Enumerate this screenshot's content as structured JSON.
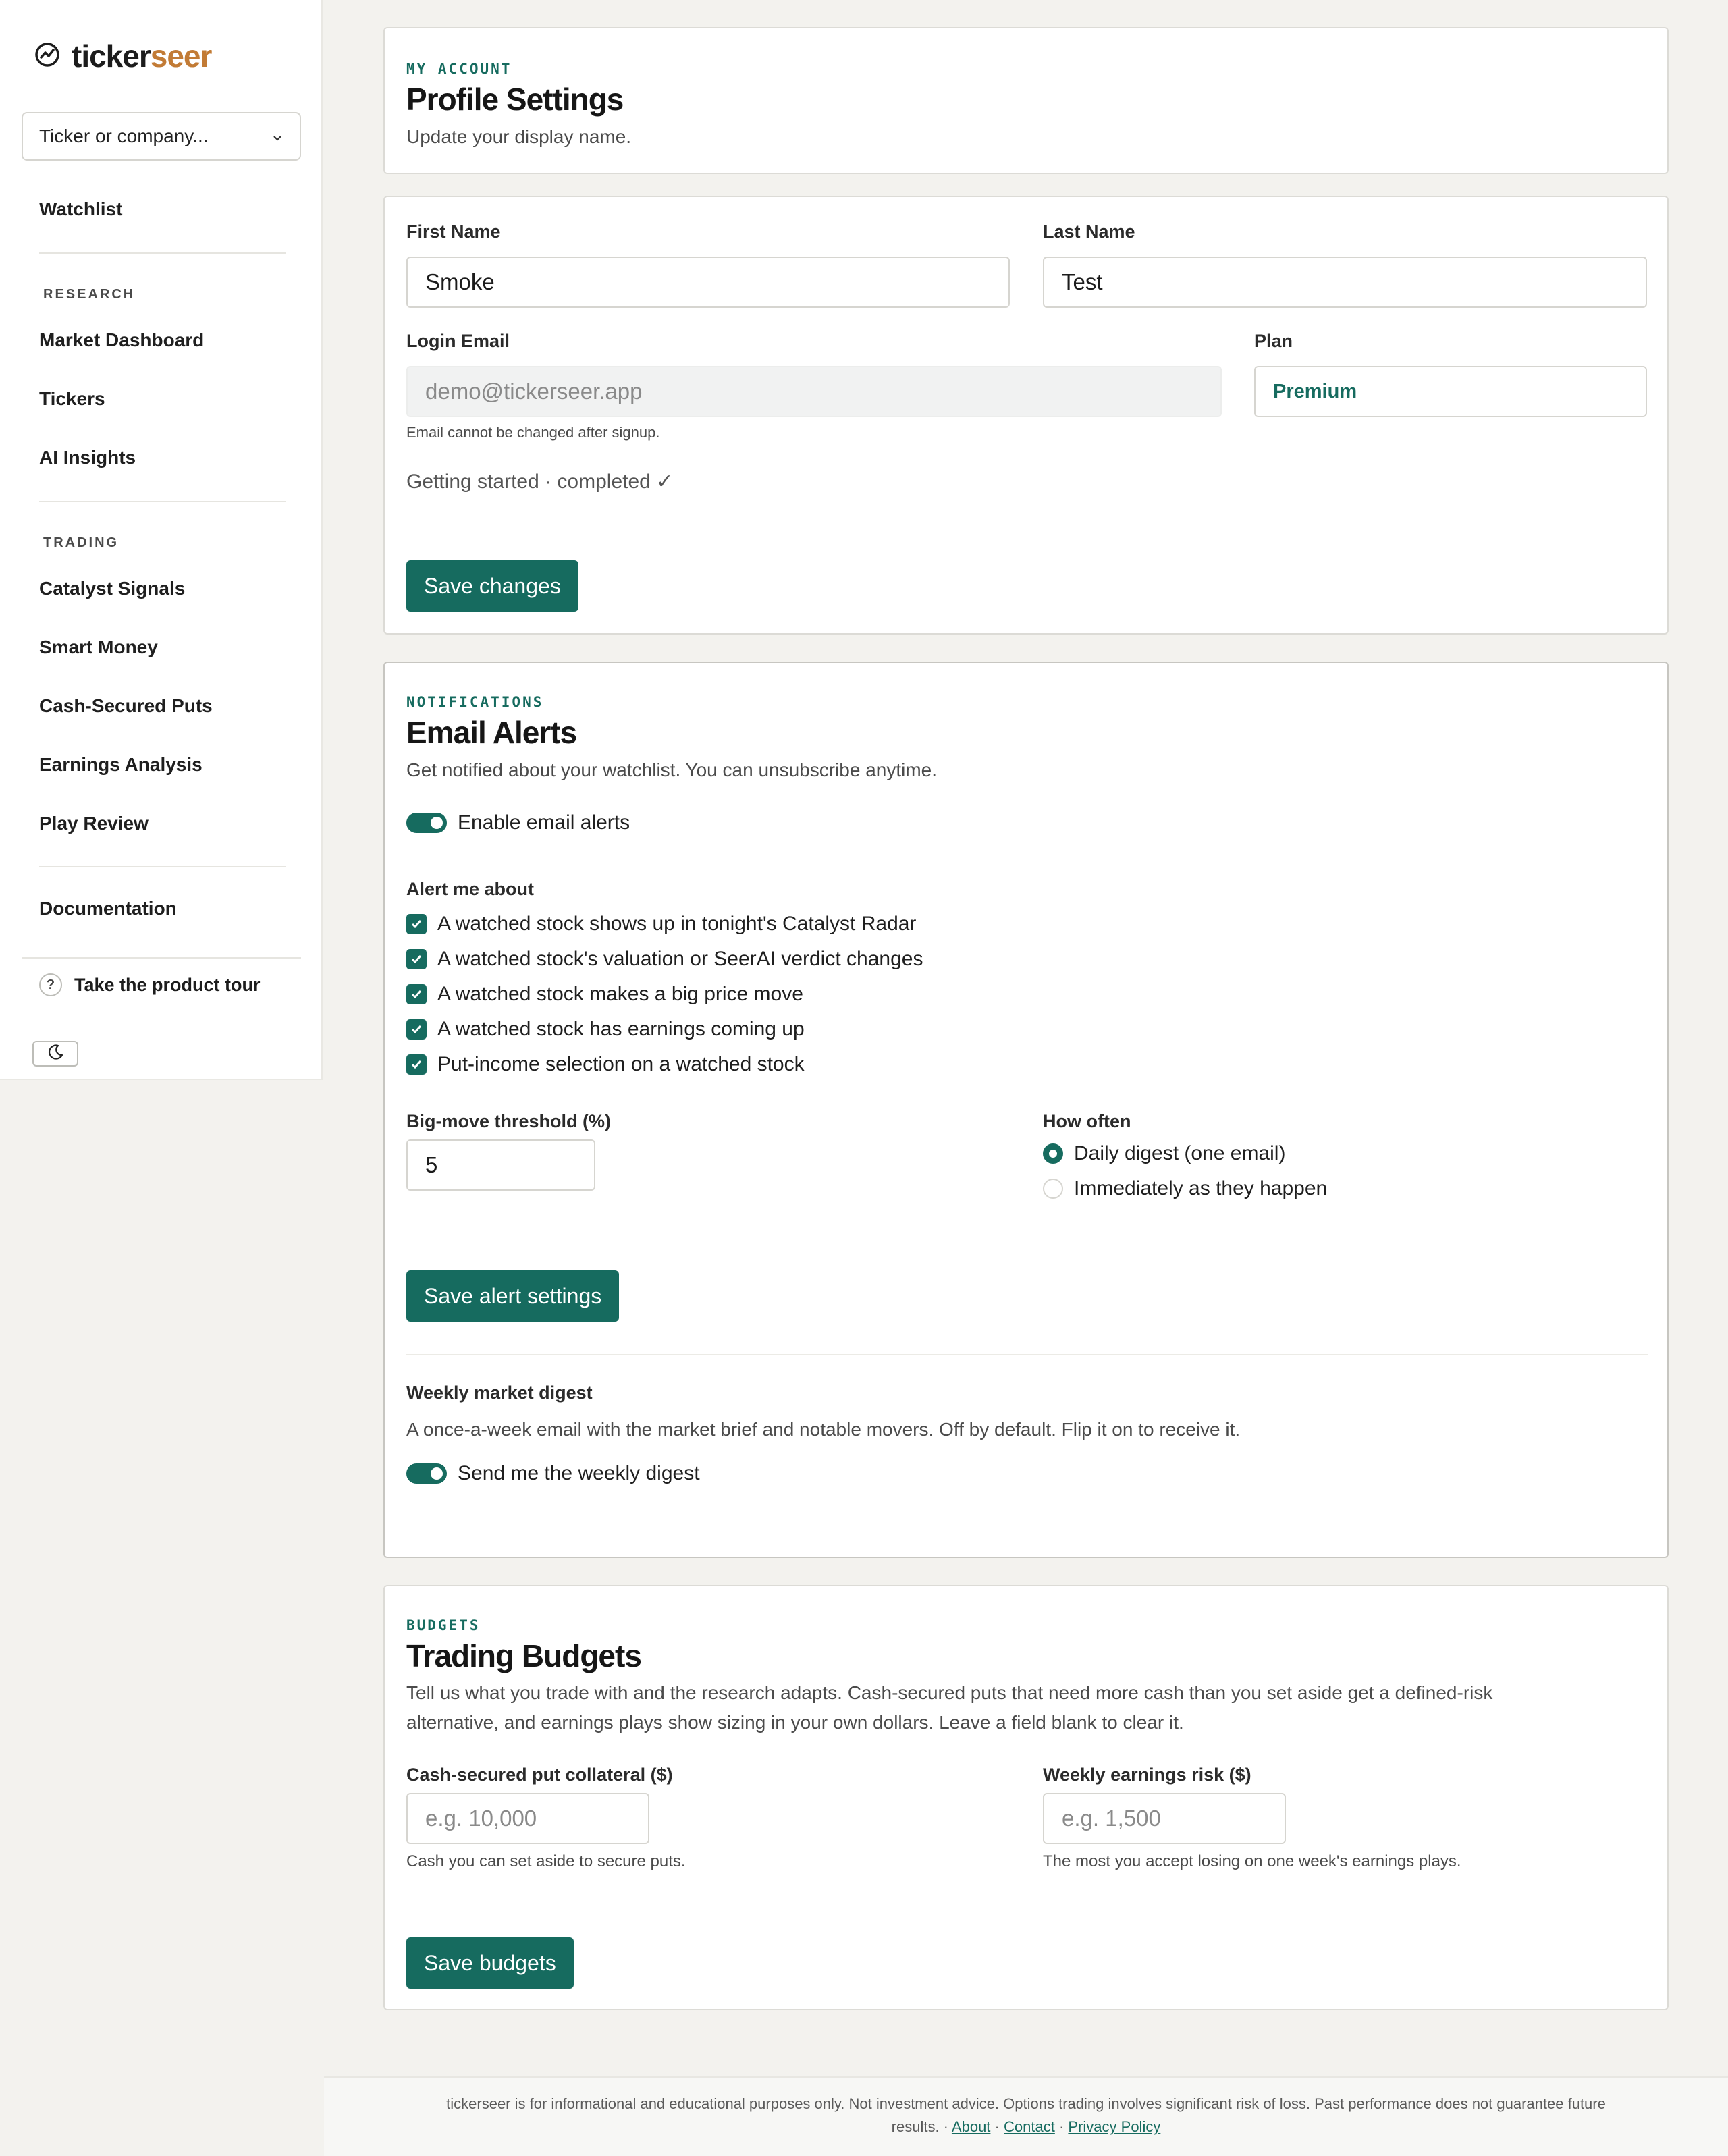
{
  "brand": {
    "name_prefix": "ticker",
    "name_suffix": "seer",
    "accent": "#166b5f",
    "brand_color": "#c27b35"
  },
  "sidebar": {
    "search_placeholder": "Ticker or company...",
    "watchlist": "Watchlist",
    "research_heading": "RESEARCH",
    "research_items": [
      "Market Dashboard",
      "Tickers",
      "AI Insights"
    ],
    "trading_heading": "TRADING",
    "trading_items": [
      "Catalyst Signals",
      "Smart Money",
      "Cash-Secured Puts",
      "Earnings Analysis",
      "Play Review"
    ],
    "documentation": "Documentation",
    "tour": "Take the product tour",
    "tour_icon": "?"
  },
  "profile": {
    "eyebrow": "MY ACCOUNT",
    "title": "Profile Settings",
    "subtitle": "Update your display name."
  },
  "profile_form": {
    "first_name_label": "First Name",
    "first_name_value": "Smoke",
    "last_name_label": "Last Name",
    "last_name_value": "Test",
    "email_label": "Login Email",
    "email_value": "demo@tickerseer.app",
    "email_hint": "Email cannot be changed after signup.",
    "plan_label": "Plan",
    "plan_value": "Premium",
    "getting_started": "Getting started · completed ✓",
    "save_label": "Save changes"
  },
  "alerts": {
    "eyebrow": "NOTIFICATIONS",
    "title": "Email Alerts",
    "subtitle": "Get notified about your watchlist. You can unsubscribe anytime.",
    "enable_label": "Enable email alerts",
    "alert_me_label": "Alert me about",
    "options": [
      "A watched stock shows up in tonight's Catalyst Radar",
      "A watched stock's valuation or SeerAI verdict changes",
      "A watched stock makes a big price move",
      "A watched stock has earnings coming up",
      "Put-income selection on a watched stock"
    ],
    "threshold_label": "Big-move threshold (%)",
    "threshold_value": "5",
    "frequency_label": "How often",
    "frequency_options": [
      "Daily digest (one email)",
      "Immediately as they happen"
    ],
    "save_label": "Save alert settings",
    "weekly_title": "Weekly market digest",
    "weekly_desc": "A once-a-week email with the market brief and notable movers. Off by default. Flip it on to receive it.",
    "weekly_toggle_label": "Send me the weekly digest"
  },
  "budgets": {
    "eyebrow": "BUDGETS",
    "title": "Trading Budgets",
    "desc_line1": "Tell us what you trade with and the research adapts. Cash-secured puts that need more cash than you set aside get a defined-risk",
    "desc_line2": "alternative, and earnings plays show sizing in your own dollars. Leave a field blank to clear it.",
    "csp_label": "Cash-secured put collateral ($)",
    "csp_placeholder": "e.g. 10,000",
    "csp_hint": "Cash you can set aside to secure puts.",
    "earn_label": "Weekly earnings risk ($)",
    "earn_placeholder": "e.g. 1,500",
    "earn_hint": "The most you accept losing on one week's earnings plays.",
    "save_label": "Save budgets"
  },
  "footer": {
    "disclaimer_line1": "tickerseer is for informational and educational purposes only. Not investment advice. Options trading involves significant risk of loss. Past performance does not guarantee future",
    "disclaimer_line2": "results. ·",
    "about": "About",
    "contact": "Contact",
    "privacy": "Privacy Policy",
    "sep": "·"
  }
}
